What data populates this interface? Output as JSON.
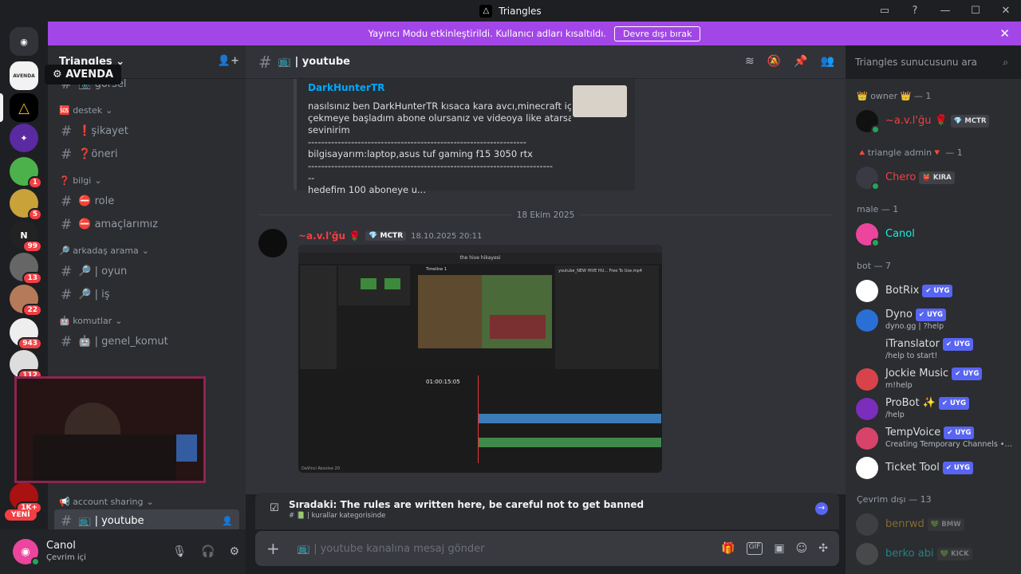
{
  "window": {
    "title": "Triangles",
    "logo_letter": "△"
  },
  "banner": {
    "text": "Yayıncı Modu etkinleştirildi. Kullanıcı adları kısaltıldı.",
    "button": "Devre dışı bırak"
  },
  "servers": {
    "home_glyph": "◉",
    "avenda_abbr": "AVENDA",
    "badges": [
      "1",
      "5",
      "99",
      "13",
      "22",
      "943",
      "112",
      "1K+",
      "1K+"
    ],
    "new_label": "YENİ"
  },
  "tooltip": {
    "text": "AVENDA"
  },
  "sidebar": {
    "server_name": "Triangles",
    "items": [
      {
        "type": "chan",
        "label": "📷 görsel",
        "partial": true
      },
      {
        "type": "cat",
        "label": "🆘 destek"
      },
      {
        "type": "chan",
        "label": "❗şikayet"
      },
      {
        "type": "chan",
        "label": "❓öneri"
      },
      {
        "type": "cat",
        "label": "❓ bilgi"
      },
      {
        "type": "chan",
        "label": "⛔ role"
      },
      {
        "type": "chan",
        "label": "⛔ amaçlarımız"
      },
      {
        "type": "cat",
        "label": "🔎 arkadaş arama"
      },
      {
        "type": "chan",
        "label": "🔎 | oyun"
      },
      {
        "type": "chan",
        "label": "🔎 | iş"
      },
      {
        "type": "cat",
        "label": "🤖 komutlar"
      },
      {
        "type": "chan",
        "label": "🤖 | genel_komut"
      }
    ],
    "account_sharing": "📢 account sharing",
    "selected_channel": "📺 | youtube"
  },
  "user": {
    "name": "Canol",
    "status": "Çevrim içi"
  },
  "chat_header": {
    "channel": "📺 | youtube"
  },
  "search": {
    "placeholder": "Triangles sunucusunu ara"
  },
  "embed": {
    "author": "DarkHunterTR",
    "lines": [
      "nasılsınız ben DarkHunterTR kısaca kara avcı,minecraft içerikleri",
      "çekmeye başladım abone olursanız ve videoya like atarsanız",
      "sevinirim",
      "------------------------------------------------------------------",
      "bilgisayarım:laptop,asus tuf gaming f15 3050 rtx",
      "--------------------------------------------------------------------------",
      "--",
      "hedefim 100 aboneye u..."
    ]
  },
  "date_divider": "18 Ekim 2025",
  "message": {
    "author": "~a.v.l'ğu 🌹",
    "tag": "💎 MCTR",
    "timestamp": "18.10.2025 20:11",
    "editor_title": "the hive hikayesi",
    "editor_timecode": "01:00:15:05",
    "editor_file": "youtube_NEW HIVE HU... Free To Use.mp4",
    "editor_app": "DaVinci Resolve 20"
  },
  "next_up": {
    "title": "Sıradaki: The rules are written here, be careful not to get banned",
    "sub": "# 📗 | kurallar kategorisinde"
  },
  "composer": {
    "placeholder": "📺 | youtube kanalına mesaj gönder"
  },
  "members": {
    "groups": [
      {
        "label": "👑 owner 👑 — 1",
        "members": [
          {
            "name": "~a.v.l'ğu 🌹",
            "color": "#f23f43",
            "tag": "💎 MCTR",
            "av": "#111111"
          }
        ]
      },
      {
        "label": "🔺triangle admin🔻 — 1",
        "members": [
          {
            "name": "Chero",
            "color": "#f23f43",
            "tag": "👹 KIRA",
            "av": "#3a3a44"
          }
        ]
      },
      {
        "label": "male — 1",
        "members": [
          {
            "name": "Canol",
            "color": "#1de9e0",
            "tag": "",
            "av": "#eb459e"
          }
        ]
      },
      {
        "label": "bot — 7",
        "members": [
          {
            "name": "BotRix",
            "color": "#dbdee1",
            "uyg": "✔ UYG",
            "sub": "",
            "av": "#ffffff"
          },
          {
            "name": "Dyno",
            "color": "#dbdee1",
            "uyg": "✔ UYG",
            "sub": "dyno.gg | ?help",
            "av": "#2a6fd6"
          },
          {
            "name": "iTranslator",
            "color": "#dbdee1",
            "uyg": "✔ UYG",
            "sub": "/help to start!",
            "av": "#2b2d31"
          },
          {
            "name": "Jockie Music",
            "color": "#dbdee1",
            "uyg": "✔ UYG",
            "sub": "m!help",
            "av": "#d8434a"
          },
          {
            "name": "ProBot ✨",
            "color": "#dbdee1",
            "uyg": "✔ UYG",
            "sub": "/help",
            "av": "#7b2dbb"
          },
          {
            "name": "TempVoice",
            "color": "#dbdee1",
            "uyg": "✔ UYG",
            "sub": "Creating Temporary Channels • /h...",
            "av": "#d8436a"
          },
          {
            "name": "Ticket Tool",
            "color": "#dbdee1",
            "uyg": "✔ UYG",
            "sub": "",
            "av": "#ffffff"
          }
        ]
      },
      {
        "label": "Çevrim dışı — 13",
        "members": [
          {
            "name": "benrwd",
            "color": "#f0b232",
            "tag": "💚 BMW",
            "av": "#555555"
          },
          {
            "name": "berko abi",
            "color": "#1de9e0",
            "tag": "💚 KICK",
            "av": "#6b6b6b"
          }
        ]
      }
    ]
  }
}
